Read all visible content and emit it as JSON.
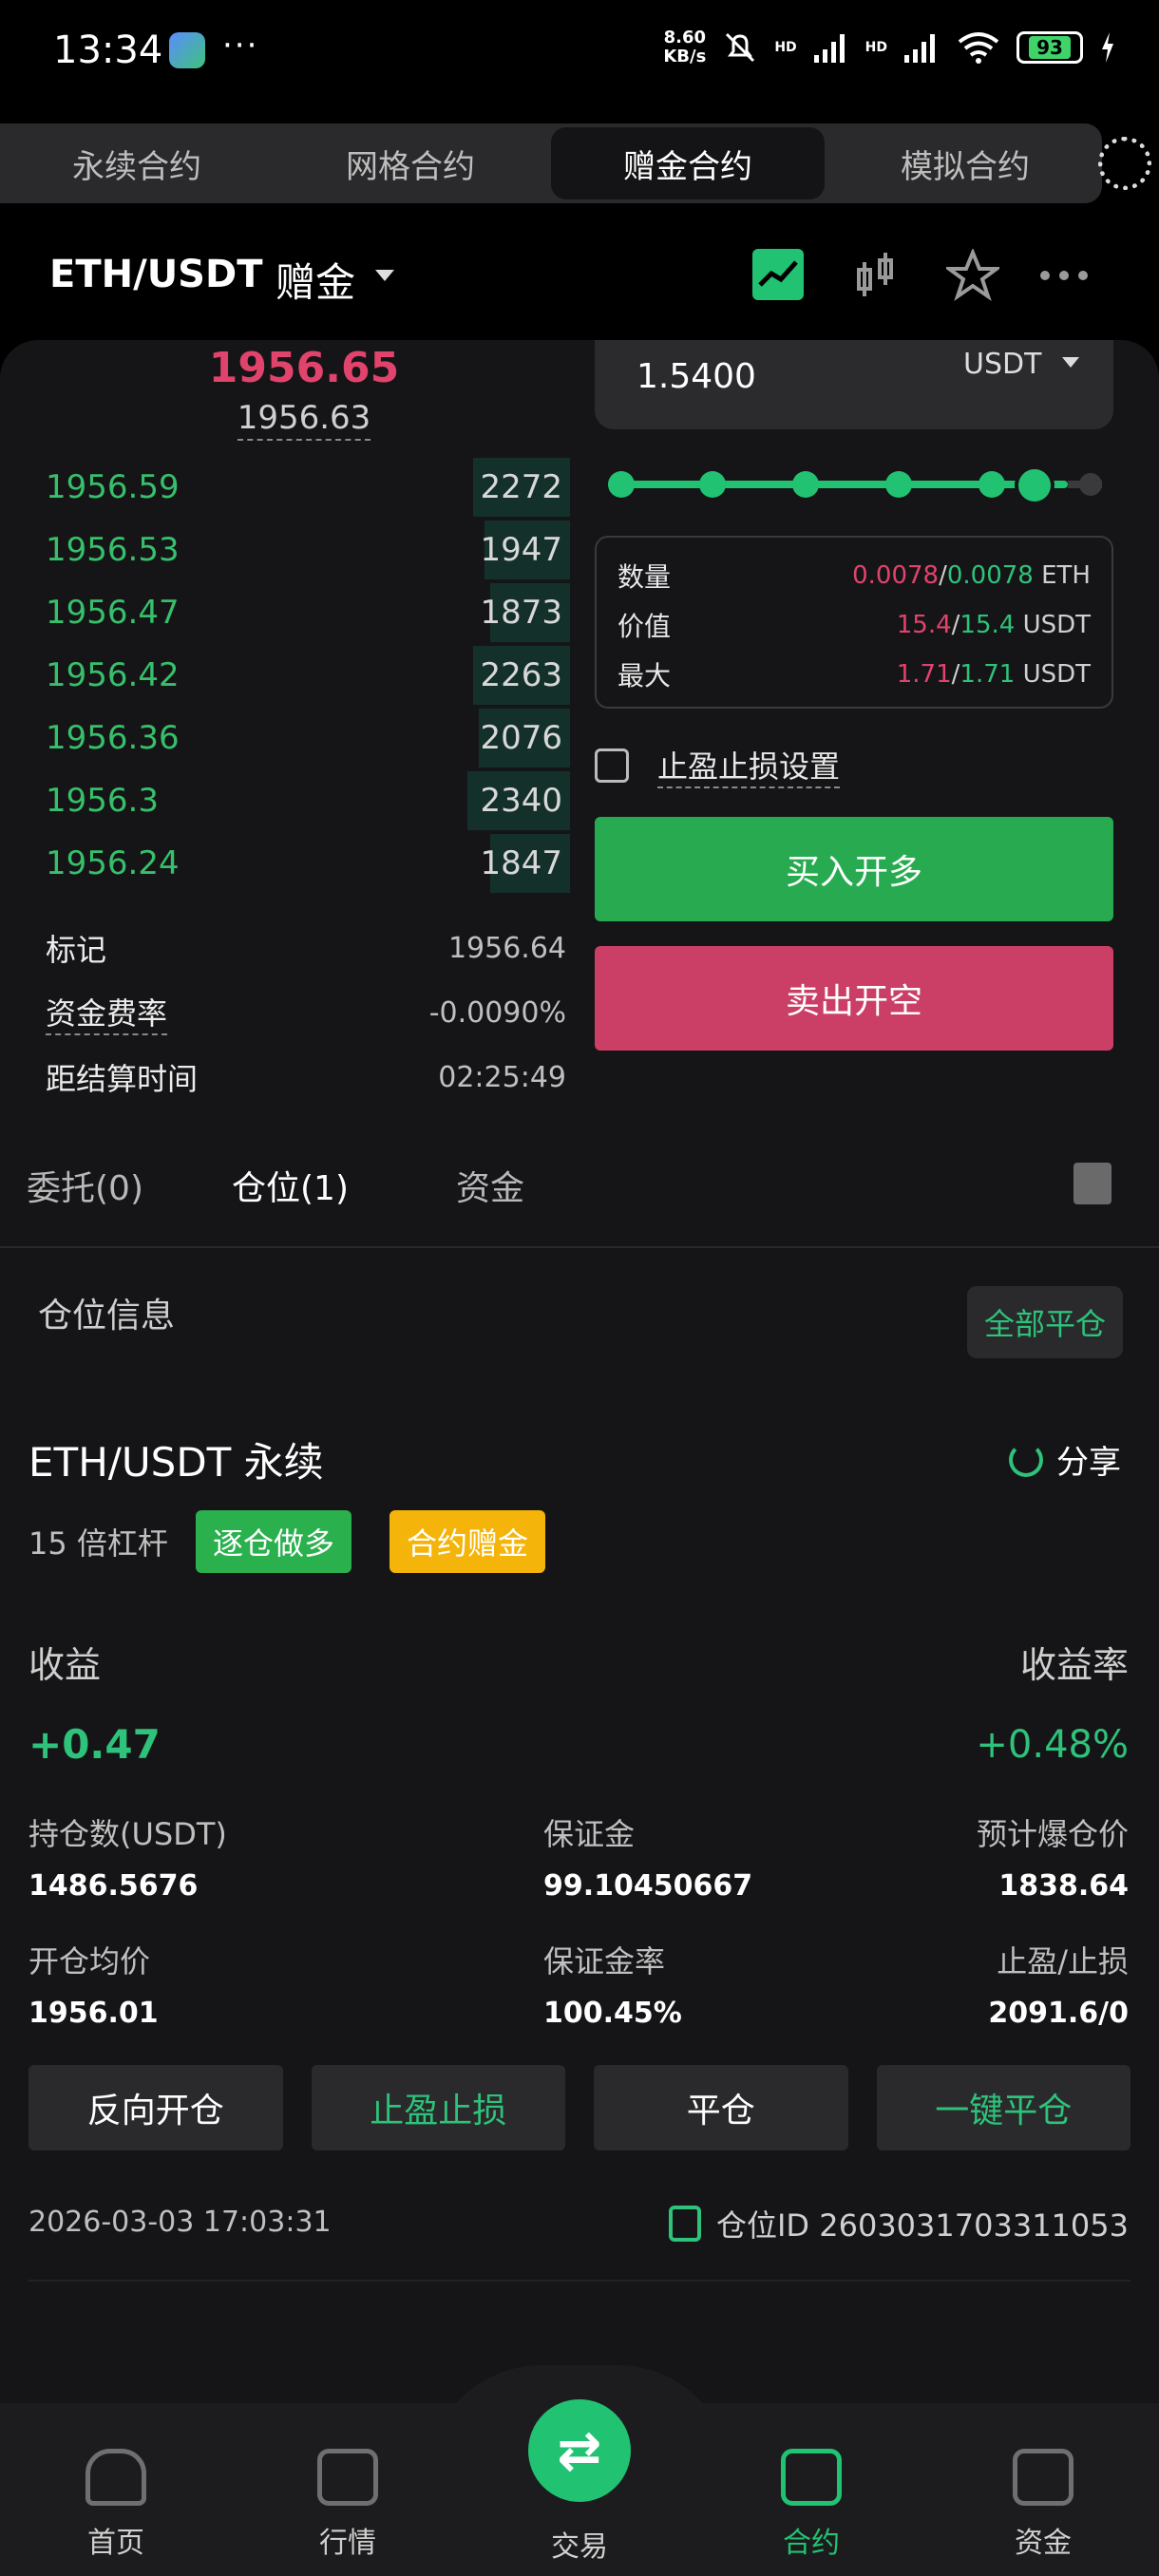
{
  "status_bar": {
    "time": "13:34",
    "net_speed_value": "8.60",
    "net_speed_unit": "KB/s",
    "battery": "93",
    "signal_label_1": "HD",
    "signal_label_2": "HD"
  },
  "mode_tabs": [
    "永续合约",
    "网格合约",
    "赠金合约",
    "模拟合约"
  ],
  "pair": {
    "name": "ETH/USDT",
    "mode": "赠金"
  },
  "orderbook": {
    "last_price": "1956.65",
    "index_price": "1956.63",
    "rows": [
      {
        "price": "1956.59",
        "qty": "2272",
        "depth": 0.17
      },
      {
        "price": "1956.53",
        "qty": "1947",
        "depth": 0.15
      },
      {
        "price": "1956.47",
        "qty": "1873",
        "depth": 0.14
      },
      {
        "price": "1956.42",
        "qty": "2263",
        "depth": 0.17
      },
      {
        "price": "1956.36",
        "qty": "2076",
        "depth": 0.16
      },
      {
        "price": "1956.3",
        "qty": "2340",
        "depth": 0.18
      },
      {
        "price": "1956.24",
        "qty": "1847",
        "depth": 0.14
      }
    ],
    "info": [
      {
        "label": "标记",
        "value": "1956.64"
      },
      {
        "label": "资金费率",
        "value": "-0.0090%"
      },
      {
        "label": "距结算时间",
        "value": "02:25:49"
      }
    ]
  },
  "order_form": {
    "amount": "1.5400",
    "unit": "USDT",
    "slider_level": 0.9,
    "summary": [
      {
        "label": "数量",
        "value_red": "0.0078",
        "value_green": "0.0078",
        "unit": "ETH"
      },
      {
        "label": "价值",
        "value_red": "15.4",
        "value_green": "15.4",
        "unit": "USDT"
      },
      {
        "label": "最大",
        "value_red": "1.71",
        "value_green": "1.71",
        "unit": "USDT"
      }
    ],
    "tpsl_label": "止盈止损设置",
    "buy_label": "买入开多",
    "sell_label": "卖出开空"
  },
  "order_tabs": {
    "orders": "委托(0)",
    "positions": "仓位(1)",
    "funds": "资金"
  },
  "position": {
    "header": "仓位信息",
    "close_all": "全部平仓",
    "title": "ETH/USDT 永续",
    "share": "分享",
    "leverage": "15 倍杠杆",
    "badge_side": "逐仓做多",
    "badge_bonus": "合约赠金",
    "pnl_label": "收益",
    "pnl_value": "+0.47",
    "roe_label": "收益率",
    "roe_value": "+0.48%",
    "stats": [
      {
        "label": "持仓数(USDT)",
        "value": "1486.5676"
      },
      {
        "label": "保证金",
        "value": "99.10450667"
      },
      {
        "label": "预计爆仓价",
        "value": "1838.64"
      },
      {
        "label": "开仓均价",
        "value": "1956.01"
      },
      {
        "label": "保证金率",
        "value": "100.45%"
      },
      {
        "label": "止盈/止损",
        "value": "2091.6/0"
      }
    ],
    "actions": [
      "反向开仓",
      "止盈止损",
      "平仓",
      "一键平仓"
    ],
    "time": "2026-03-03 17:03:31",
    "id_label": "仓位ID 2603031703311053"
  },
  "nav": [
    "首页",
    "行情",
    "交易",
    "合约",
    "资金"
  ],
  "colors": {
    "accent": "#21c272",
    "red": "#e0436c",
    "buy": "#28ab50",
    "sell": "#cb3f66",
    "badge_yellow": "#f5b40a"
  }
}
